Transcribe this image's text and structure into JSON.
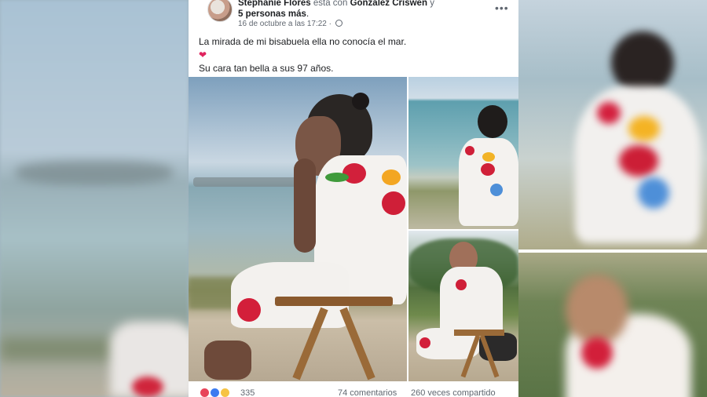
{
  "post": {
    "author": "Stephanie Flores",
    "with_text": "está con",
    "tagged": "Gonzalez Criswen",
    "conjunction": "y",
    "others": "5 personas más",
    "period": ".",
    "timestamp": "16 de octubre a las 17:22 ·",
    "more_label": "•••",
    "text_line1": "La mirada de mi bisabuela ella no conocía el mar.",
    "heart": "❤",
    "text_line2": "Su cara tan bella a sus 97 años."
  },
  "stats": {
    "reaction_count": "335",
    "comments": "74 comentarios",
    "shares": "260 veces compartido",
    "reactions": [
      "love-icon",
      "like-icon",
      "haha-icon"
    ]
  },
  "colors": {
    "text": "#1c1e21",
    "muted": "#606770",
    "heart": "#e0245e",
    "love": "#e8445a",
    "like": "#3b7bf0",
    "haha": "#f6c344"
  }
}
